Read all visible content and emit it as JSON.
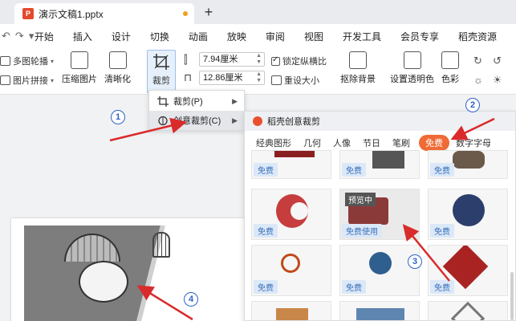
{
  "tabbar": {
    "doc_icon_text": "P",
    "doc_title": "演示文稿1.pptx",
    "new_tab": "+"
  },
  "menubar": {
    "quick": [
      "↶",
      "↷",
      "▾"
    ],
    "items": [
      "开始",
      "插入",
      "设计",
      "切换",
      "动画",
      "放映",
      "审阅",
      "视图",
      "开发工具",
      "会员专享",
      "稻壳资源"
    ]
  },
  "ribbon": {
    "multi_outline": "多图轮播",
    "image_stitch": "图片拼接",
    "compress": "压缩图片",
    "sharpen": "清晰化",
    "crop": "裁剪",
    "width": "7.94厘米",
    "height": "12.86厘米",
    "lock_ratio": "锁定纵横比",
    "reset_size": "重设大小",
    "remove_bg": "抠除背景",
    "set_transparent": "设置透明色",
    "color": "色彩"
  },
  "dropdown": {
    "items": [
      {
        "label": "裁剪(P)"
      },
      {
        "label": "创意裁剪(C)"
      }
    ]
  },
  "panel": {
    "title": "稻壳创意裁剪",
    "categories": [
      "经典图形",
      "几何",
      "人像",
      "节日",
      "笔刷",
      "免费",
      "数字字母"
    ],
    "selected_category": "免费",
    "cards": [
      {
        "badge": "免费"
      },
      {
        "badge": "免费"
      },
      {
        "badge": "免费"
      },
      {
        "badge": "免费"
      },
      {
        "badge": "免费使用",
        "tag": "预览中"
      },
      {
        "badge": "免费"
      },
      {
        "badge": "免费"
      },
      {
        "badge": "免费"
      },
      {
        "badge": "免费"
      }
    ]
  },
  "annotations": {
    "n1": "1",
    "n2": "2",
    "n3": "3",
    "n4": "4"
  },
  "colors": {
    "accent": "#f06a35",
    "arrow": "#d92b2b",
    "badge_text": "#3a6fb8",
    "callout": "#2e62c6"
  }
}
